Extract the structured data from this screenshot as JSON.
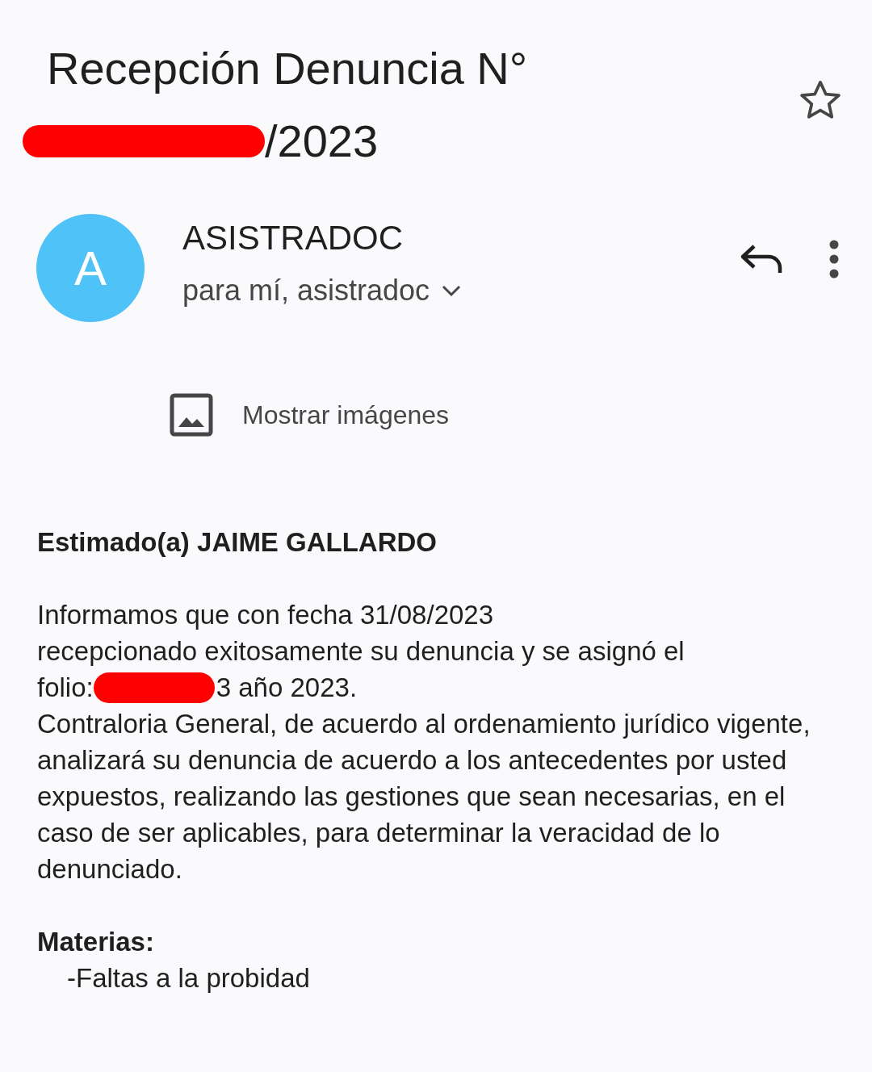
{
  "subject": {
    "line_1": "Recepción Denuncia N°",
    "line_2": "/2023",
    "starred": false
  },
  "sender": {
    "avatar_letter": "A",
    "name": "ASISTRADOC",
    "recipients": "para mí, asistradoc"
  },
  "images_prompt": {
    "label": "Mostrar imágenes"
  },
  "body": {
    "greeting": "Estimado(a) JAIME GALLARDO",
    "lines": [
      "Informamos que con fecha 31/08/2023",
      "recepcionado exitosamente su denuncia y se asignó el"
    ],
    "folio_label": "folio:",
    "folio_rest": "3 año 2023.",
    "paragraph": "Contraloria General, de acuerdo al ordenamiento jurídico vigente, analizará su denuncia de acuerdo a los antecedentes por usted expuestos, realizando las gestiones que sean necesarias, en el caso de ser aplicables, para determinar la veracidad de lo denunciado.",
    "topics_heading": "Materias:",
    "topics": [
      "-Faltas a la probidad"
    ]
  }
}
